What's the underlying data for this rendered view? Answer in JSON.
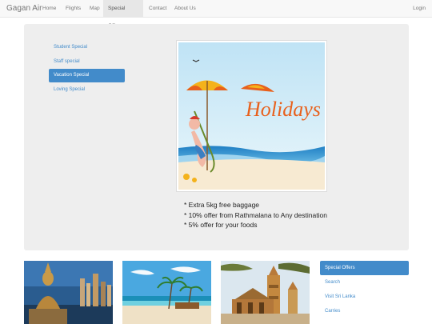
{
  "navbar": {
    "brand": "Gagan Air",
    "items": [
      "Home",
      "Flights",
      "Map",
      "Special Offers",
      "Contact",
      "About Us"
    ],
    "active_index": 3,
    "login": "Login"
  },
  "offers_menu": {
    "items": [
      "Student Special",
      "Staff special",
      "Vacation Special",
      "Loving Special"
    ],
    "active_index": 2
  },
  "promo": {
    "image_text": "Holidays",
    "lines": [
      "* Extra 5kg free baggage",
      "* 10% offer from Rathmalana to Any destination",
      "* 5% offer for your foods"
    ]
  },
  "side_menu": {
    "items": [
      "Special Offers",
      "Search",
      "Visit Sri Lanka",
      "Carries"
    ],
    "active_index": 0
  },
  "colors": {
    "accent": "#428bca",
    "navbar_bg": "#f8f8f8",
    "jumbotron_bg": "#eeeeee"
  }
}
